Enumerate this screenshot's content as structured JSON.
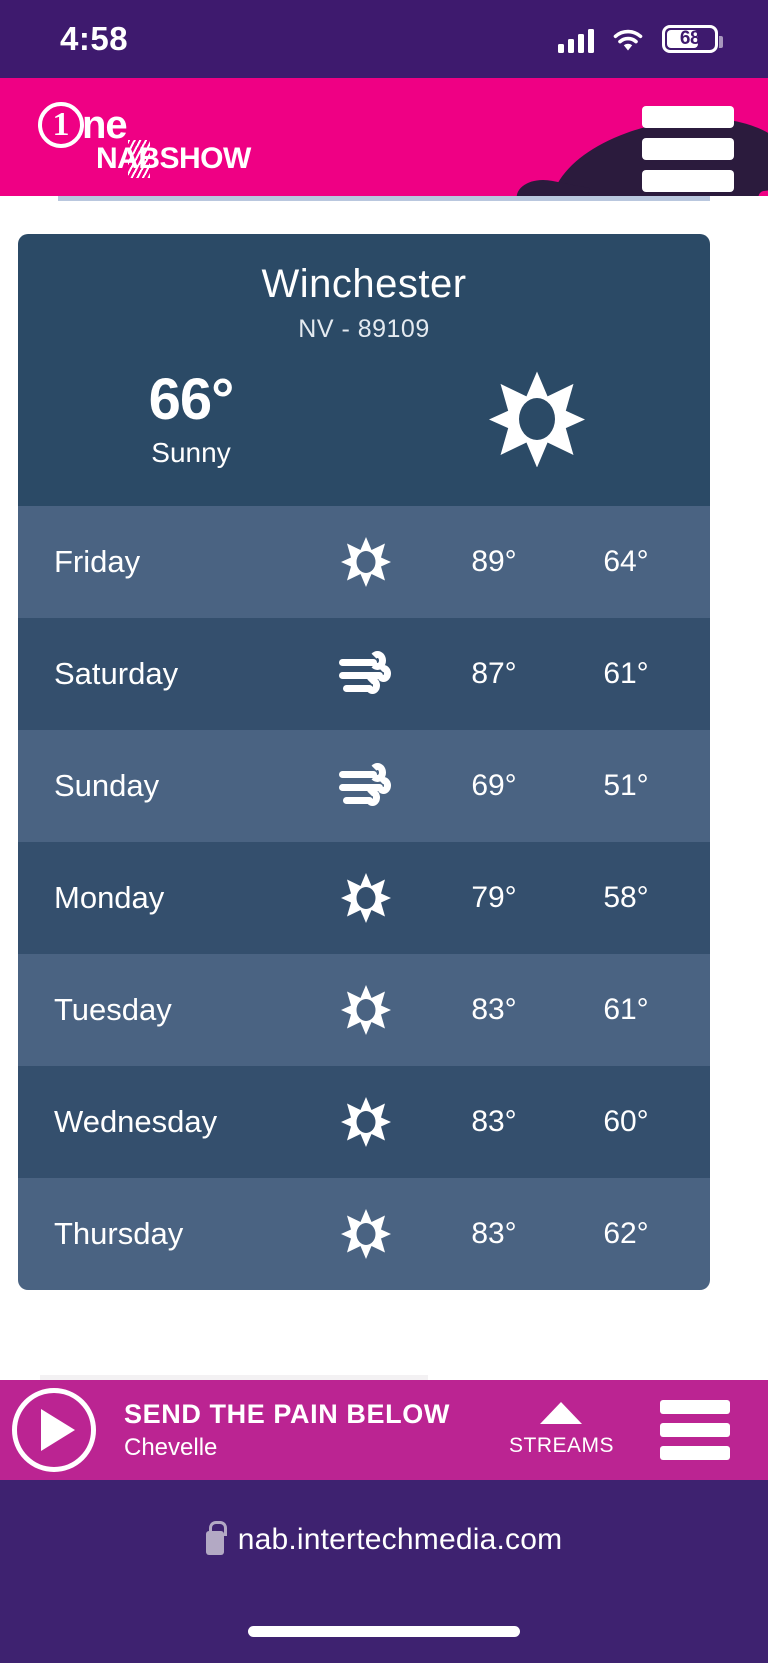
{
  "statusbar": {
    "time": "4:58",
    "signal_icon": "signal-bars-icon",
    "wifi_icon": "wifi-icon",
    "battery_level": "68"
  },
  "header": {
    "logo_numeral": "1",
    "logo_word": "ne",
    "logo_sub": "NABSHOW",
    "menu_icon": "hamburger-menu-icon",
    "brand_color": "#ef0084"
  },
  "weather": {
    "city": "Winchester",
    "region": "NV - 89109",
    "current_temp": "66°",
    "condition": "Sunny",
    "condition_icon": "sun-icon",
    "header_color": "#2b4a66",
    "row_light_color": "#4a6382",
    "row_dark_color": "#344f6d",
    "forecast": [
      {
        "day": "Friday",
        "icon": "sun-icon",
        "high": "89°",
        "low": "64°"
      },
      {
        "day": "Saturday",
        "icon": "wind-icon",
        "high": "87°",
        "low": "61°"
      },
      {
        "day": "Sunday",
        "icon": "wind-icon",
        "high": "69°",
        "low": "51°"
      },
      {
        "day": "Monday",
        "icon": "sun-icon",
        "high": "79°",
        "low": "58°"
      },
      {
        "day": "Tuesday",
        "icon": "sun-icon",
        "high": "83°",
        "low": "61°"
      },
      {
        "day": "Wednesday",
        "icon": "sun-icon",
        "high": "83°",
        "low": "60°"
      },
      {
        "day": "Thursday",
        "icon": "sun-icon",
        "high": "83°",
        "low": "62°"
      }
    ]
  },
  "player": {
    "play_icon": "play-icon",
    "track_title": "SEND THE PAIN BELOW",
    "track_artist": "Chevelle",
    "streams_label": "STREAMS",
    "streams_icon": "caret-up-icon",
    "menu_icon": "hamburger-menu-icon",
    "bar_color": "#bb2492"
  },
  "browser": {
    "lock_icon": "lock-icon",
    "url": "nab.intertechmedia.com"
  }
}
